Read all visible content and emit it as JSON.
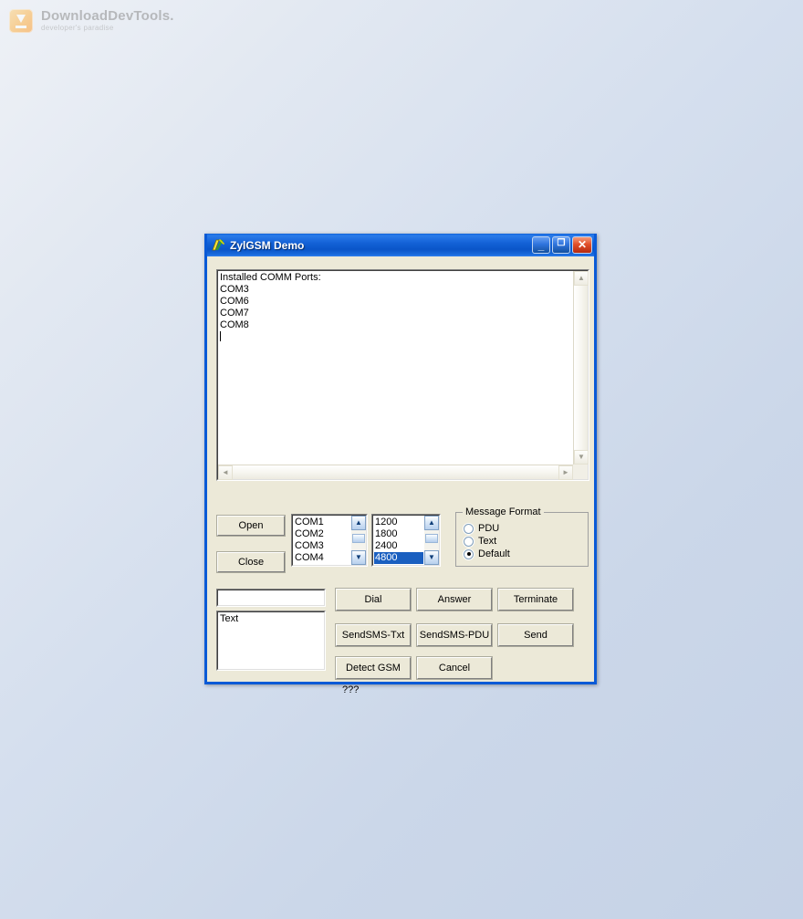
{
  "watermark": {
    "title": "DownloadDevTools.",
    "tagline": "developer's paradise",
    "icon": "download-arrow-icon"
  },
  "window": {
    "title": "ZylGSM Demo",
    "icon": "delphi-app-icon",
    "controls": {
      "minimize": "minimize-icon",
      "minimize_glyph": "_",
      "maximize": "maximize-icon",
      "maximize_glyph": "❐",
      "close": "close-icon",
      "close_glyph": "✕"
    },
    "accent_titlebar": "#0a5ad6",
    "client_background": "#ece9d8"
  },
  "log_memo": {
    "lines": [
      "Installed COMM Ports:",
      "COM3",
      "COM6",
      "COM7",
      "COM8"
    ],
    "text": "Installed COMM Ports:\nCOM3\nCOM6\nCOM7\nCOM8",
    "caret_visible": true,
    "scroll_arrows": {
      "up": "▲",
      "down": "▼",
      "left": "◄",
      "right": "►"
    }
  },
  "connection": {
    "open_label": "Open",
    "close_label": "Close",
    "com_ports": {
      "items": [
        "COM1",
        "COM2",
        "COM3",
        "COM4"
      ],
      "selected_index": -1
    },
    "baud_rates": {
      "items": [
        "1200",
        "1800",
        "2400",
        "4800"
      ],
      "selected": "4800",
      "selected_index": 3
    }
  },
  "message_format": {
    "title": "Message Format",
    "options": [
      {
        "label": "PDU",
        "checked": false
      },
      {
        "label": "Text",
        "checked": false
      },
      {
        "label": "Default",
        "checked": true
      }
    ]
  },
  "compose": {
    "phone_value": "",
    "phone_placeholder": "",
    "message_value": "Text"
  },
  "actions": {
    "dial": "Dial",
    "answer": "Answer",
    "terminate": "Terminate",
    "sendsms_txt": "SendSMS-Txt",
    "sendsms_pdu": "SendSMS-PDU",
    "send": "Send",
    "detect_gsm": "Detect GSM",
    "cancel": "Cancel"
  },
  "status": {
    "text": "???"
  }
}
